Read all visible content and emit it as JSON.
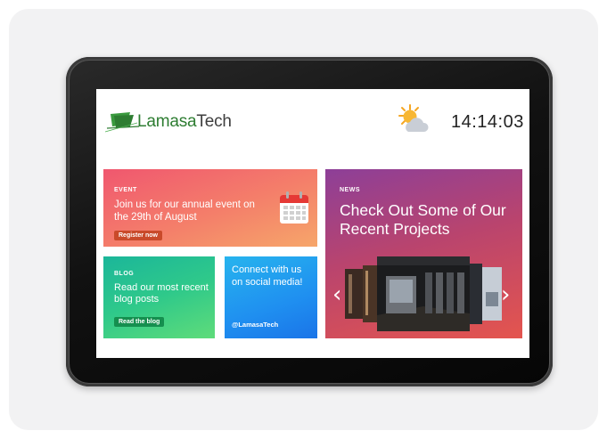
{
  "header": {
    "brand_part1": "Lamasa",
    "brand_part2": "Tech",
    "weather_icon": "partly-cloudy-icon",
    "clock": "14:14:03"
  },
  "event_tile": {
    "tag": "EVENT",
    "text": "Join us for our annual event on the 29th of August",
    "button": "Register now",
    "icon": "calendar-icon"
  },
  "blog_tile": {
    "tag": "BLOG",
    "text": "Read our most recent blog posts",
    "button": "Read the blog"
  },
  "social_tile": {
    "text": "Connect with us on social media!",
    "handle": "@LamasaTech"
  },
  "news_tile": {
    "tag": "NEWS",
    "headline": "Check Out Some of Our Recent Projects",
    "prev_icon": "chevron-left-icon",
    "next_icon": "chevron-right-icon"
  },
  "colors": {
    "brand_green": "#2e7d32",
    "event_gradient": [
      "#f0576f",
      "#f6a66a"
    ],
    "blog_gradient": [
      "#1bb69a",
      "#5fdc7a"
    ],
    "social_gradient": [
      "#27b4ee",
      "#1a74e8"
    ],
    "news_gradient": [
      "#8d3f98",
      "#e4554e"
    ]
  }
}
